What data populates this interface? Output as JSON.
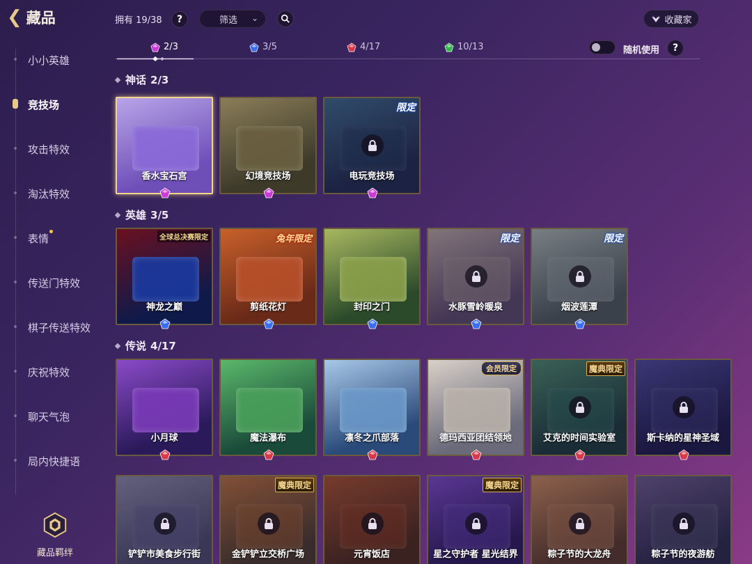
{
  "header": {
    "title": "藏品"
  },
  "sidebar": {
    "items": [
      {
        "label": "小小英雄",
        "active": false,
        "badge": false
      },
      {
        "label": "竞技场",
        "active": true,
        "badge": false
      },
      {
        "label": "攻击特效",
        "active": false,
        "badge": false
      },
      {
        "label": "淘汰特效",
        "active": false,
        "badge": false
      },
      {
        "label": "表情",
        "active": false,
        "badge": true
      },
      {
        "label": "传送门特效",
        "active": false,
        "badge": false
      },
      {
        "label": "棋子传送特效",
        "active": false,
        "badge": false
      },
      {
        "label": "庆祝特效",
        "active": false,
        "badge": false
      },
      {
        "label": "聊天气泡",
        "active": false,
        "badge": false
      },
      {
        "label": "局内快捷语",
        "active": false,
        "badge": false
      }
    ],
    "bond_label": "藏品羁绊"
  },
  "topbar": {
    "owned_label": "拥有",
    "owned_count": "19/38",
    "help": "?",
    "filter_label": "筛选",
    "collector_label": "收藏家"
  },
  "tiers": [
    {
      "count": "2/3",
      "color": "#c93ad6",
      "active": true
    },
    {
      "count": "3/5",
      "color": "#3a6ef0",
      "active": false
    },
    {
      "count": "4/17",
      "color": "#d63a4a",
      "active": false
    },
    {
      "count": "10/13",
      "color": "#2eb84a",
      "active": false
    }
  ],
  "random_use": {
    "label": "随机使用",
    "enabled": false
  },
  "sections": [
    {
      "name": "神话",
      "count": "2/3",
      "gem_color": "#c93ad6",
      "cards": [
        {
          "name": "香水宝石宫",
          "locked": false,
          "selected": true,
          "tag": "",
          "bg1": "#6e4fb8",
          "bg2": "#b8a4e8",
          "board": "#8a6ad8"
        },
        {
          "name": "幻境竞技场",
          "locked": false,
          "selected": false,
          "tag": "",
          "bg1": "#3d3a2a",
          "bg2": "#8a7d58",
          "board": "#6a6040"
        },
        {
          "name": "电玩竞技场",
          "locked": true,
          "selected": false,
          "tag": "限定",
          "bg1": "#1d2a4a",
          "bg2": "#3b6a8a",
          "board": "#1f3a5a"
        }
      ]
    },
    {
      "name": "英雄",
      "count": "3/5",
      "gem_color": "#3a6ef0",
      "cards": [
        {
          "name": "神龙之巅",
          "locked": false,
          "selected": false,
          "tag": "全球总决赛限定",
          "bg1": "#0f1a4a",
          "bg2": "#6a1020",
          "board": "#1a3aa0"
        },
        {
          "name": "剪纸花灯",
          "locked": false,
          "selected": false,
          "tag": "兔年限定",
          "bg1": "#6a2a18",
          "bg2": "#c8602a",
          "board": "#b8502a"
        },
        {
          "name": "封印之门",
          "locked": false,
          "selected": false,
          "tag": "",
          "bg1": "#2a4a2a",
          "bg2": "#a8b860",
          "board": "#8aa04a"
        },
        {
          "name": "水豚雪岭暖泉",
          "locked": true,
          "selected": false,
          "tag": "限定",
          "bg1": "#5a4a6a",
          "bg2": "#b8a8a0",
          "board": "#988a88"
        },
        {
          "name": "烟波莲潭",
          "locked": true,
          "selected": false,
          "tag": "限定",
          "bg1": "#4a5a5a",
          "bg2": "#a8b8b0",
          "board": "#8a9a98"
        }
      ]
    },
    {
      "name": "传说",
      "count": "4/17",
      "gem_color": "#d63a4a",
      "cards": [
        {
          "name": "小月球",
          "locked": false,
          "selected": false,
          "tag": "",
          "bg1": "#2a1a5a",
          "bg2": "#8a4ac8",
          "board": "#7a3ab8"
        },
        {
          "name": "魔法瀑布",
          "locked": false,
          "selected": false,
          "tag": "",
          "bg1": "#1a4a3a",
          "bg2": "#5ab86a",
          "board": "#4aa05a"
        },
        {
          "name": "凛冬之爪部落",
          "locked": false,
          "selected": false,
          "tag": "",
          "bg1": "#2a4a7a",
          "bg2": "#a8c8e8",
          "board": "#6a98c8"
        },
        {
          "name": "德玛西亚团结领地",
          "locked": false,
          "selected": false,
          "tag": "会员限定",
          "bg1": "#6a6a7a",
          "bg2": "#d8d0c8",
          "board": "#b8b0a8"
        },
        {
          "name": "艾克的时间实验室",
          "locked": true,
          "selected": false,
          "tag": "魔典限定",
          "bg1": "#1a3a3a",
          "bg2": "#4a8a6a",
          "board": "#2a6a5a"
        },
        {
          "name": "斯卡纳的星神圣域",
          "locked": true,
          "selected": false,
          "tag": "",
          "bg1": "#1a1a4a",
          "bg2": "#4a4a9a",
          "board": "#3a3a7a"
        }
      ]
    },
    {
      "name": "",
      "count": "",
      "gem_color": "#d63a4a",
      "cards": [
        {
          "name": "铲铲市美食步行街",
          "locked": true,
          "selected": false,
          "tag": "",
          "bg1": "#4a4a6a",
          "bg2": "#8a8aa8",
          "board": "#5a5a8a"
        },
        {
          "name": "金铲铲立交桥广场",
          "locked": true,
          "selected": false,
          "tag": "魔典限定",
          "bg1": "#4a3a2a",
          "bg2": "#b8703a",
          "board": "#9a5a2a"
        },
        {
          "name": "元宵饭店",
          "locked": true,
          "selected": false,
          "tag": "",
          "bg1": "#4a2a1a",
          "bg2": "#a8502a",
          "board": "#8a3a1a"
        },
        {
          "name": "星之守护者 星光结界",
          "locked": true,
          "selected": false,
          "tag": "魔典限定",
          "bg1": "#2a1a5a",
          "bg2": "#7a4ac8",
          "board": "#5a3aa8"
        },
        {
          "name": "粽子节的大龙舟",
          "locked": true,
          "selected": false,
          "tag": "",
          "bg1": "#5a3a2a",
          "bg2": "#c88a5a",
          "board": "#a8704a"
        },
        {
          "name": "粽子节的夜游舫",
          "locked": true,
          "selected": false,
          "tag": "",
          "bg1": "#2a2a4a",
          "bg2": "#6a5a8a",
          "board": "#4a4a6a"
        }
      ]
    }
  ]
}
